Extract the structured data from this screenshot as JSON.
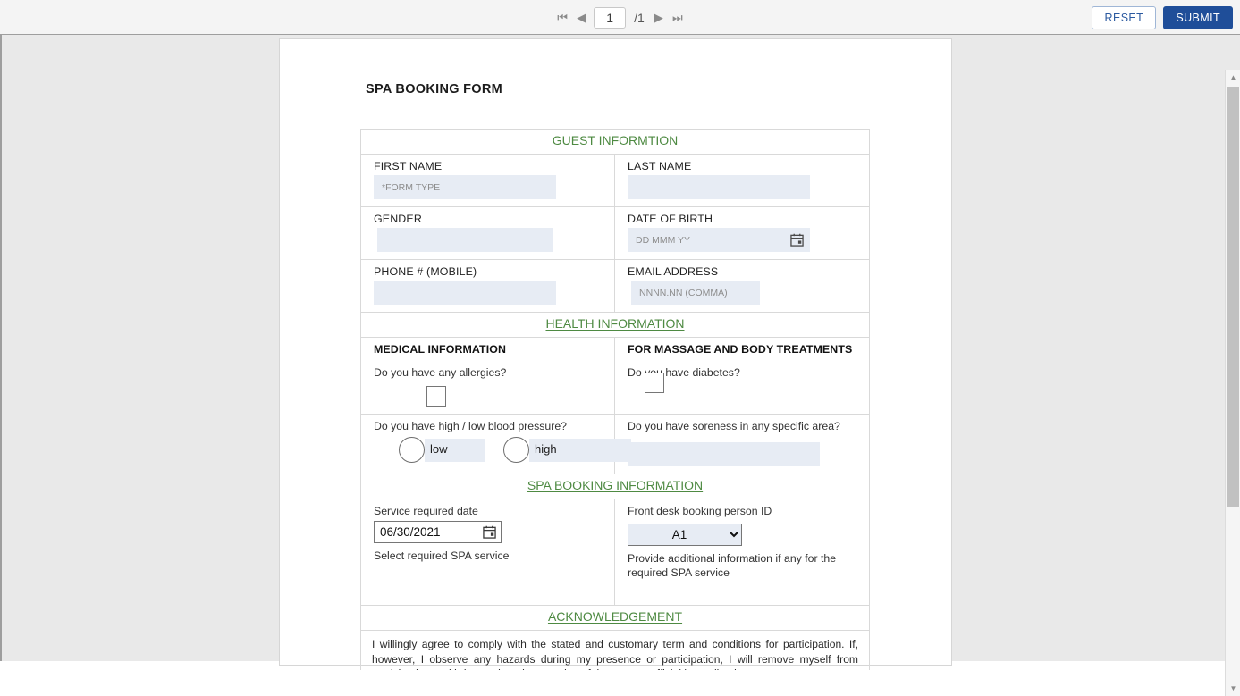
{
  "toolbar": {
    "first_page_icon": "first-page",
    "prev_page_icon": "prev-page",
    "page_number": "1",
    "page_total": "/1",
    "next_page_icon": "next-page",
    "last_page_icon": "last-page",
    "reset_label": "RESET",
    "submit_label": "SUBMIT"
  },
  "document": {
    "title": "SPA BOOKING FORM",
    "sections": {
      "guest": {
        "heading": "GUEST INFORMTION",
        "first_name_label": "FIRST NAME",
        "first_name_placeholder": "*FORM TYPE",
        "first_name_value": "",
        "last_name_label": "LAST NAME",
        "last_name_value": "",
        "gender_label": "GENDER",
        "gender_value": "",
        "dob_label": "DATE OF BIRTH",
        "dob_placeholder": "DD MMM YY",
        "dob_value": "",
        "phone_label": "PHONE # (MOBILE)",
        "phone_value": "",
        "email_label": "EMAIL ADDRESS",
        "email_placeholder": "NNNN.NN (COMMA)",
        "email_value": ""
      },
      "health": {
        "heading": "HEALTH INFORMATION",
        "left_subhead": "MEDICAL INFORMATION",
        "right_subhead": "FOR MASSAGE AND BODY TREATMENTS",
        "allergies_question": "Do you have any allergies?",
        "diabetes_question": "Do you have diabetes?",
        "blood_pressure_question": "Do you have high / low blood pressure?",
        "bp_low_label": "low",
        "bp_low_value": "",
        "bp_high_label": "high",
        "bp_high_value": "",
        "soreness_question": "Do you have soreness in any specific area?",
        "soreness_value": ""
      },
      "booking": {
        "heading": "SPA BOOKING INFORMATION",
        "service_date_label": "Service required date",
        "service_date_value": "06/30/2021",
        "front_desk_label": "Front desk booking person ID",
        "front_desk_value": "A1",
        "front_desk_options": [
          "A1"
        ],
        "select_service_label": "Select required SPA service",
        "additional_info_label": "Provide additional information if any for the required SPA service"
      },
      "acknowledgement": {
        "heading": "ACKNOWLEDGEMENT",
        "body": "I willingly agree to comply with the stated and customary term and conditions for participation. If, however, I observe any hazards during my presence or participation, I will remove myself from participation and bring such to the attention of the nearest official immediately."
      }
    }
  },
  "colors": {
    "section_heading": "#4e8a42",
    "submit_bg": "#1f4e99",
    "reset_text": "#2c5aa0",
    "field_bg": "#e7ecf4"
  }
}
